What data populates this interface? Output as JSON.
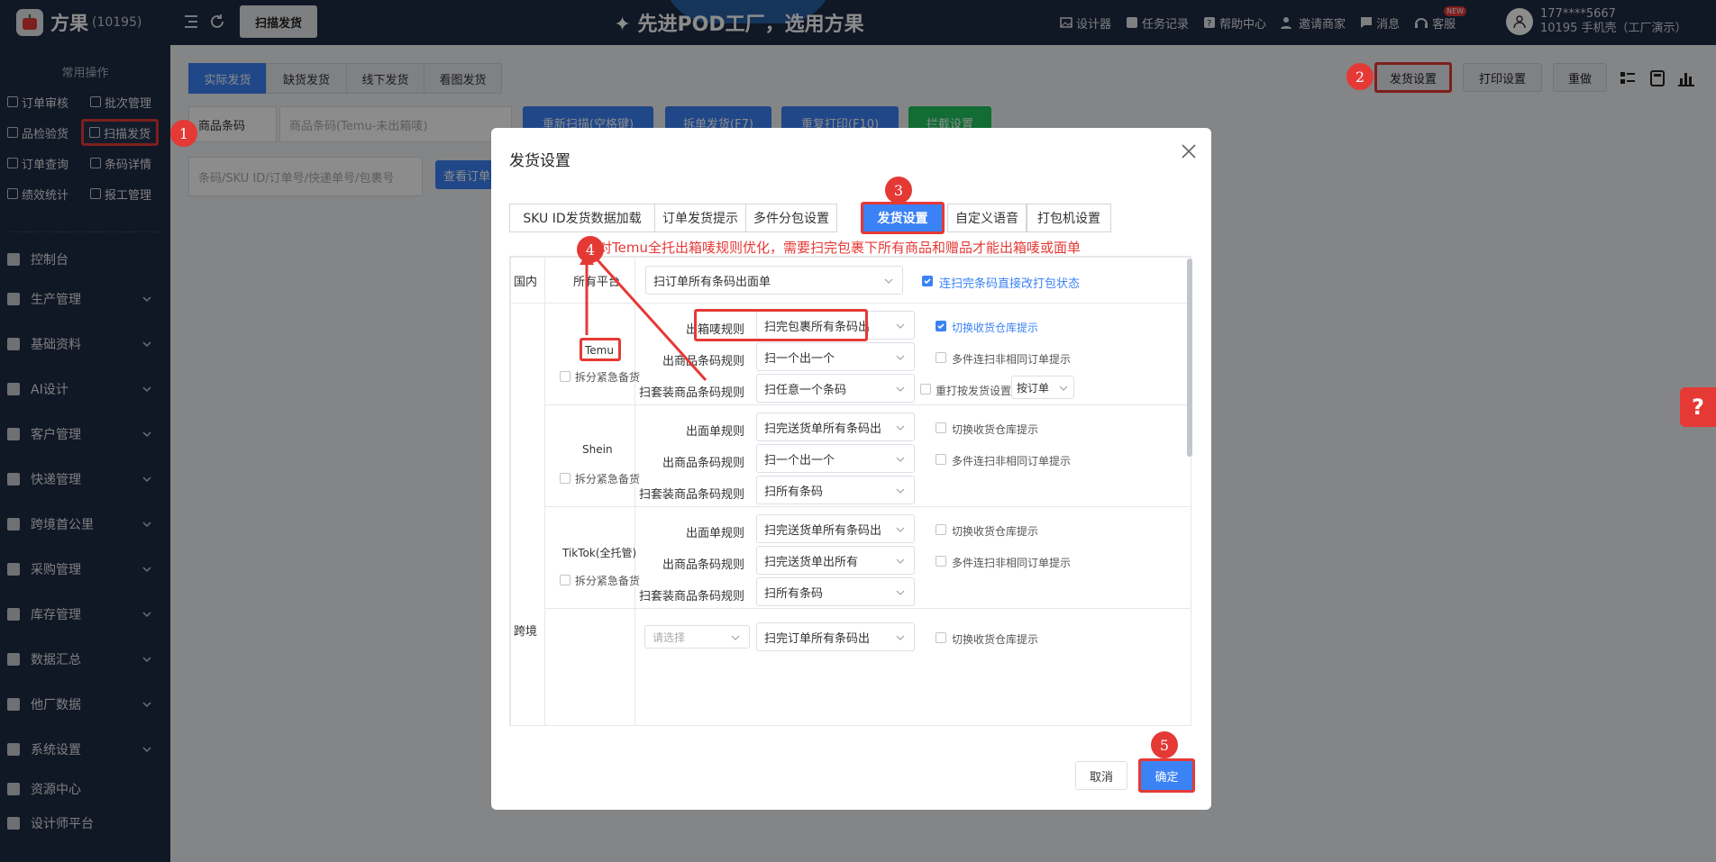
{
  "app": {
    "logo_text": "方果",
    "logo_id": "(10195)",
    "banner": "✦ 先进POD工厂，选用方果",
    "active_tab": "扫描发货"
  },
  "topnav": {
    "items": [
      "设计器",
      "任务记录",
      "帮助中心",
      "邀请商家",
      "消息",
      "客服"
    ],
    "new_badge": "NEW"
  },
  "user": {
    "phone": "177****5667",
    "org": "10195 手机壳（工厂演示）"
  },
  "sidebar": {
    "section_title": "常用操作",
    "quick": [
      "订单审核",
      "批次管理",
      "品检验货",
      "扫描发货",
      "订单查询",
      "条码详情",
      "绩效统计",
      "报工管理"
    ],
    "menu": [
      "控制台",
      "生产管理",
      "基础资料",
      "AI设计",
      "客户管理",
      "快递管理",
      "跨境首公里",
      "采购管理",
      "库存管理",
      "数据汇总",
      "他厂数据",
      "系统设置",
      "资源中心",
      "设计师平台"
    ]
  },
  "main": {
    "segments": [
      "实际发货",
      "缺货发货",
      "线下发货",
      "看图发货"
    ],
    "right_buttons": [
      "发货设置",
      "打印设置",
      "重做"
    ],
    "product_select": "商品条码",
    "barcode_placeholder": "商品条码(Temu-未出箱唛)",
    "rescan": "重新扫描(空格键)",
    "split_ship": "拆单发货(F7)",
    "reprint": "重复打印(F10)",
    "intercept": "拦截设置",
    "search_placeholder": "条码/SKU ID/订单号/快递单号/包裹号",
    "view_order": "查看订单"
  },
  "dialog": {
    "title": "发货设置",
    "tabs": [
      "SKU ID发货数据加载",
      "订单发货提示",
      "多件分包设置",
      "发货设置",
      "自定义语音",
      "打包机设置"
    ],
    "tip": "针对Temu全托出箱唛规则优化，需要扫完包裹下所有商品和赠品才能出箱唛或面单",
    "domestic": {
      "label": "国内",
      "platform": "所有平台",
      "rule": "扫订单所有条码出面单",
      "check": "连扫完条码直接改打包状态"
    },
    "crossborder_label": "跨境",
    "platforms": [
      {
        "name": "Temu",
        "split": "拆分紧急备货",
        "rules": [
          {
            "label": "出箱唛规则",
            "value": "扫完包裹所有条码出",
            "check": "切换收货仓库提示",
            "checked": true
          },
          {
            "label": "出商品条码规则",
            "value": "扫一个出一个",
            "check": "多件连扫非相同订单提示",
            "checked": false
          },
          {
            "label": "扫套装商品条码规则",
            "value": "扫任意一个条码",
            "check": "重打按发货设置走",
            "checked": false,
            "extra": "按订单"
          }
        ]
      },
      {
        "name": "Shein",
        "split": "拆分紧急备货",
        "rules": [
          {
            "label": "出面单规则",
            "value": "扫完送货单所有条码出",
            "check": "切换收货仓库提示"
          },
          {
            "label": "出商品条码规则",
            "value": "扫一个出一个",
            "check": "多件连扫非相同订单提示"
          },
          {
            "label": "扫套装商品条码规则",
            "value": "扫所有条码",
            "check": ""
          }
        ]
      },
      {
        "name": "TikTok(全托管)",
        "split": "拆分紧急备货",
        "rules": [
          {
            "label": "出面单规则",
            "value": "扫完送货单所有条码出",
            "check": "切换收货仓库提示"
          },
          {
            "label": "出商品条码规则",
            "value": "扫完送货单出所有",
            "check": "多件连扫非相同订单提示"
          },
          {
            "label": "扫套装商品条码规则",
            "value": "扫所有条码",
            "check": ""
          }
        ]
      },
      {
        "name": "",
        "split": "",
        "rules": [
          {
            "label": "",
            "placeholder": "请选择",
            "value": "扫完订单所有条码出",
            "check": "切换收货仓库提示"
          }
        ]
      }
    ],
    "cancel": "取消",
    "confirm": "确定"
  },
  "callouts": [
    "1",
    "2",
    "3",
    "4",
    "5"
  ],
  "colors": {
    "accent": "#3b82f6",
    "annotation": "#e53935",
    "sidebar": "#1e2a44",
    "green": "#22c55e"
  }
}
